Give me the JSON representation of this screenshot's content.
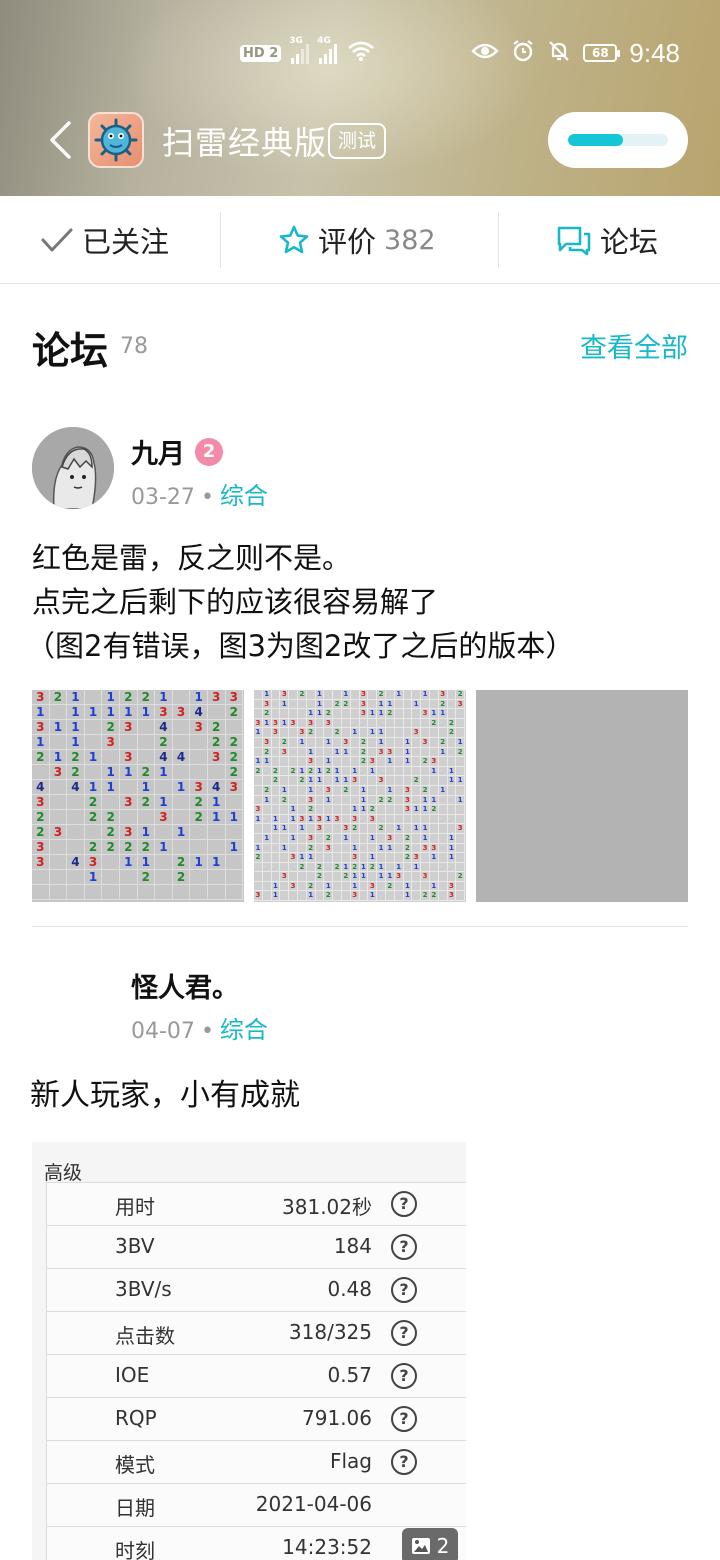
{
  "status_bar": {
    "hd_label": "HD",
    "sim_label": "2",
    "net1": "3G",
    "net2": "4G",
    "battery": "68",
    "time": "9:48"
  },
  "header": {
    "title": "扫雷经典版",
    "badge": "测试",
    "download_progress": 0.55
  },
  "tabs": [
    {
      "label": "已关注"
    },
    {
      "label": "评价",
      "count": "382"
    },
    {
      "label": "论坛"
    }
  ],
  "forum": {
    "title": "论坛",
    "count": "78",
    "view_all": "查看全部"
  },
  "posts": [
    {
      "author": "九月",
      "level": "2",
      "date": "03-27",
      "category": "综合",
      "lines": [
        "红色是雷，反之则不是。",
        "点完之后剩下的应该很容易解了",
        "（图2有错误，图3为图2改了之后的版本）"
      ]
    },
    {
      "author": "怪人君。",
      "date": "04-07",
      "category": "综合",
      "text": "新人玩家，小有成就",
      "stats": {
        "title": "高级",
        "rows": [
          {
            "label": "用时",
            "value": "381.02秒",
            "help": true
          },
          {
            "label": "3BV",
            "value": "184",
            "help": true
          },
          {
            "label": "3BV/s",
            "value": "0.48",
            "help": true
          },
          {
            "label": "点击数",
            "value": "318/325",
            "help": true
          },
          {
            "label": "IOE",
            "value": "0.57",
            "help": true
          },
          {
            "label": "RQP",
            "value": "791.06",
            "help": true
          },
          {
            "label": "模式",
            "value": "Flag",
            "help": true
          },
          {
            "label": "日期",
            "value": "2021-04-06",
            "help": false
          },
          {
            "label": "时刻",
            "value": "14:23:52",
            "help": false
          }
        ],
        "image_count": "2"
      }
    }
  ],
  "colors": {
    "accent": "#19b8c8",
    "level_badge": "#f28aa8"
  }
}
